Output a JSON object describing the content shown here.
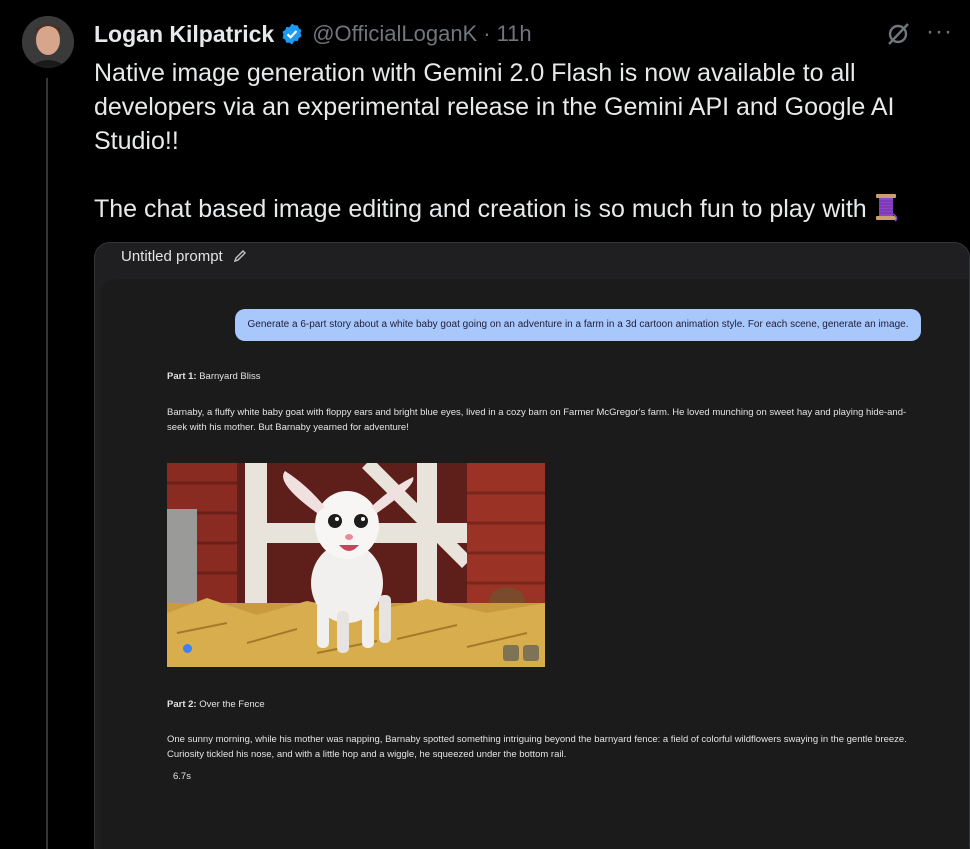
{
  "tweet": {
    "author_name": "Logan Kilpatrick",
    "handle": "@OfficialLoganK",
    "separator": "·",
    "time": "11h",
    "paragraph_1": "Native image generation with Gemini 2.0 Flash is now available to all developers via an experimental release in the Gemini API and Google AI Studio!!",
    "paragraph_2": "The chat based image editing and creation is so much fun to play with",
    "more_glyph": "···"
  },
  "studio": {
    "prompt_title": "Untitled prompt",
    "user_prompt": "Generate a 6-part story about a white baby goat going on an adventure in a farm in a 3d cartoon animation style. For each scene, generate an image.",
    "part1_label": "Part 1:",
    "part1_title": " Barnyard Bliss",
    "part1_text": "Barnaby, a fluffy white baby goat with floppy ears and bright blue eyes, lived in a cozy barn on Farmer McGregor's farm. He loved munching on sweet hay and playing hide-and-seek with his mother. But Barnaby yearned for adventure!",
    "part2_label": "Part 2:",
    "part2_title": " Over the Fence",
    "part2_text": "One sunny morning, while his mother was napping, Barnaby spotted something intriguing beyond the barnyard fence: a field of colorful wildflowers swaying in the gentle breeze. Curiosity tickled his nose, and with a little hop and a wiggle, he squeezed under the bottom rail.",
    "elapsed": "6.7s"
  },
  "colors": {
    "background": "#000000",
    "verified_blue": "#1d9bf0",
    "prompt_bubble": "#a8c7fa",
    "muted_text": "#71767b"
  },
  "icons": [
    "verified-badge-icon",
    "grok-icon",
    "more-icon",
    "spool-of-thread-icon",
    "pencil-icon",
    "download-icon",
    "settings-icon"
  ]
}
